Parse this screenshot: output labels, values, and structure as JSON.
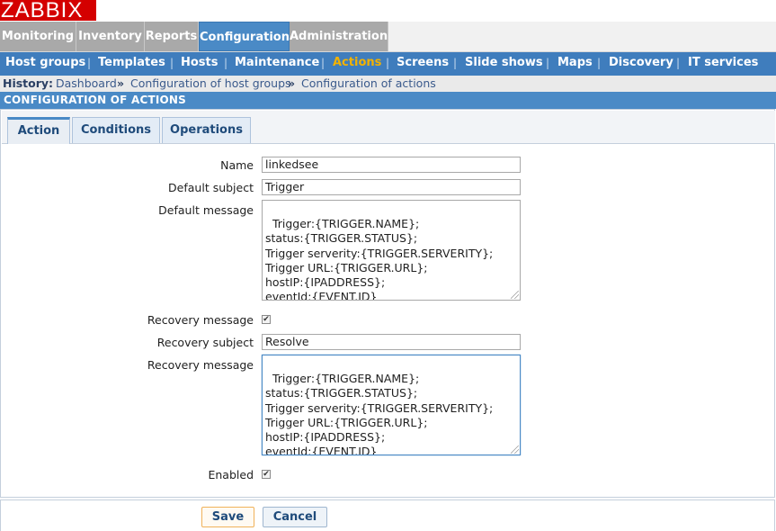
{
  "logo": "ZABBIX",
  "main_menu": [
    {
      "label": "Monitoring"
    },
    {
      "label": "Inventory"
    },
    {
      "label": "Reports"
    },
    {
      "label": "Configuration"
    },
    {
      "label": "Administration"
    }
  ],
  "sub_menu": [
    {
      "label": "Host groups"
    },
    {
      "label": "Templates"
    },
    {
      "label": "Hosts"
    },
    {
      "label": "Maintenance"
    },
    {
      "label": "Actions"
    },
    {
      "label": "Screens"
    },
    {
      "label": "Slide shows"
    },
    {
      "label": "Maps"
    },
    {
      "label": "Discovery"
    },
    {
      "label": "IT services"
    }
  ],
  "sub_menu_separator": "|",
  "history": {
    "label": "History:",
    "links": [
      "Dashboard",
      "Configuration of host groups",
      "Configuration of actions"
    ],
    "arrow": "»"
  },
  "page_title": "CONFIGURATION OF ACTIONS",
  "tabs": [
    {
      "label": "Action"
    },
    {
      "label": "Conditions"
    },
    {
      "label": "Operations"
    }
  ],
  "form": {
    "name_label": "Name",
    "name_value": "linkedsee",
    "default_subject_label": "Default subject",
    "default_subject_value": "Trigger",
    "default_message_label": "Default message",
    "default_message_value": "Trigger:{TRIGGER.NAME};\nstatus:{TRIGGER.STATUS};\nTrigger serverity:{TRIGGER.SERVERITY};\nTrigger URL:{TRIGGER.URL};\nhostIP:{IPADDRESS};\neventId:{EVENT.ID}",
    "recovery_message_checkbox_label": "Recovery message",
    "recovery_message_checked": "✔",
    "recovery_subject_label": "Recovery subject",
    "recovery_subject_value": "Resolve",
    "recovery_message_label": "Recovery message",
    "recovery_message_value": "Trigger:{TRIGGER.NAME};\nstatus:{TRIGGER.STATUS};\nTrigger serverity:{TRIGGER.SERVERITY};\nTrigger URL:{TRIGGER.URL};\nhostIP:{IPADDRESS};\neventId:{EVENT.ID}",
    "enabled_label": "Enabled",
    "enabled_checked": "✔"
  },
  "buttons": {
    "save": "Save",
    "cancel": "Cancel"
  },
  "colors": {
    "logo_red": "#d40000",
    "menu_blue": "#4a8ac6",
    "submenu_blue": "#3f7dbd",
    "active_submenu": "#f3b200"
  }
}
